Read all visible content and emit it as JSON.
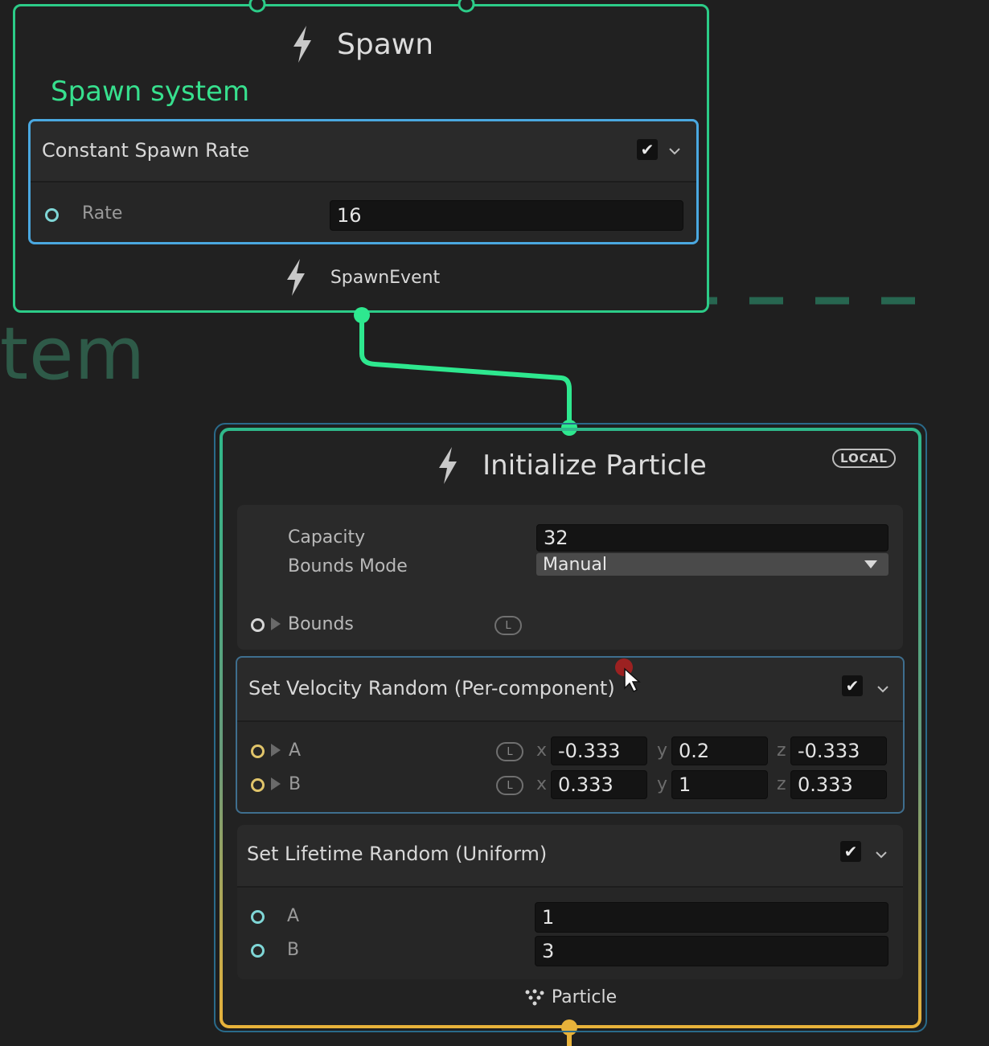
{
  "system": {
    "label_fragment": "stem"
  },
  "spawn_context": {
    "title": "Spawn",
    "system_name": "Spawn system",
    "block": {
      "title": "Constant Spawn Rate",
      "enabled": true,
      "rate_label": "Rate",
      "rate_value": "16"
    },
    "output_label": "SpawnEvent"
  },
  "init_context": {
    "title": "Initialize Particle",
    "space_badge": "LOCAL",
    "settings": {
      "capacity_label": "Capacity",
      "capacity_value": "32",
      "bounds_mode_label": "Bounds Mode",
      "bounds_mode_value": "Manual",
      "bounds_label": "Bounds",
      "bounds_badge": "L"
    },
    "velocity_block": {
      "title": "Set Velocity Random (Per-component)",
      "enabled": true,
      "a_label": "A",
      "b_label": "B",
      "badge": "L",
      "axis_x": "x",
      "axis_y": "y",
      "axis_z": "z",
      "a": {
        "x": "-0.333",
        "y": "0.2",
        "z": "-0.333"
      },
      "b": {
        "x": "0.333",
        "y": "1",
        "z": "0.333"
      }
    },
    "lifetime_block": {
      "title": "Set Lifetime Random (Uniform)",
      "enabled": true,
      "a_label": "A",
      "a_value": "1",
      "b_label": "B",
      "b_value": "3"
    },
    "output_label": "Particle"
  },
  "colors": {
    "spawn_border": "#2ccc88",
    "link": "#2ee88f",
    "init_border_gradient": [
      "#2fb88a",
      "#e8b23a"
    ],
    "system_dashes": "#2a6a4e"
  },
  "icons": [
    "bolt-icon",
    "check-icon",
    "chevron-down-icon",
    "expand-triangle-icon",
    "particle-icon",
    "mouse-cursor-icon"
  ]
}
